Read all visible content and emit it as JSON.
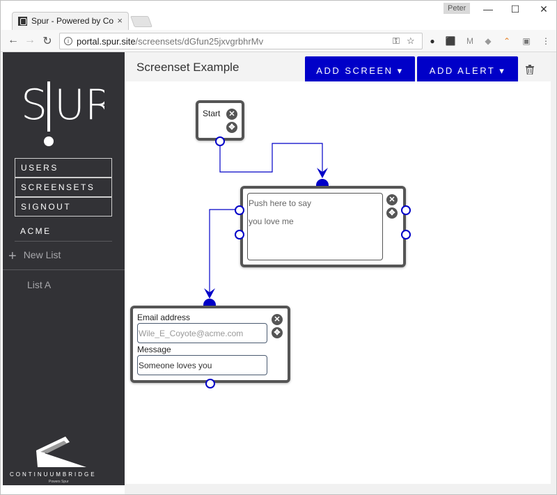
{
  "browser": {
    "tab_title": "Spur - Powered by Conti",
    "tab_close": "×",
    "profile_name": "Peter",
    "window_controls": {
      "minimize": "—",
      "maximize": "☐",
      "close": "✕"
    },
    "url_host": "portal.spur.site",
    "url_path": "/screensets/dGfun25jxvgrbhrMv",
    "nav": {
      "back": "←",
      "forward": "→",
      "reload": "↻"
    },
    "extensions": [
      "evernote-icon",
      "pdf-icon",
      "gmail-icon",
      "dropbox-icon",
      "analytics-icon",
      "extension-icon",
      "menu-icon"
    ]
  },
  "sidebar": {
    "logo_text": "SPUR",
    "nav_items": [
      {
        "label": "USERS"
      },
      {
        "label": "SCREENSETS"
      },
      {
        "label": "SIGNOUT"
      }
    ],
    "org_name": "ACME",
    "new_list_plus": "+",
    "new_list_label": "New List",
    "lists": [
      {
        "label": "List A"
      }
    ],
    "footer_logo_text": "CONTINUUMBRIDGE",
    "footer_logo_sub": "Powers Spur"
  },
  "header": {
    "title": "Screenset Example",
    "add_screen_label": "ADD SCREEN",
    "add_alert_label": "ADD ALERT",
    "caret": "▾",
    "trash_icon": "trash-icon"
  },
  "canvas": {
    "start_node": {
      "label": "Start"
    },
    "text_node": {
      "line1": "Push here to say",
      "line2": "you love me"
    },
    "form_node": {
      "email_label": "Email address",
      "email_placeholder": "Wile_E_Coyote@acme.com",
      "message_label": "Message",
      "message_value": "Someone loves you"
    },
    "close_glyph": "✕",
    "move_glyph": "✥",
    "connector_color": "#0000c8"
  },
  "colors": {
    "accent": "#0000c8",
    "sidebar": "#323236",
    "node_border": "#555555"
  }
}
